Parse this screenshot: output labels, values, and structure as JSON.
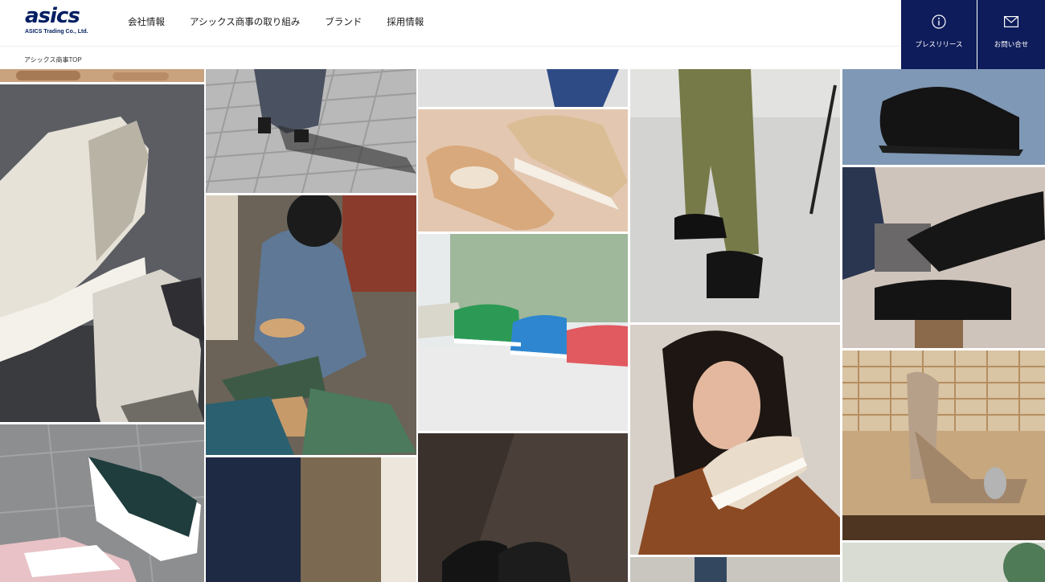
{
  "brand": {
    "logo_text": "asics",
    "company": "ASICS Trading Co., Ltd."
  },
  "nav": {
    "items": [
      {
        "label": "会社情報"
      },
      {
        "label": "アシックス商事の取り組み"
      },
      {
        "label": "ブランド"
      },
      {
        "label": "採用情報"
      }
    ]
  },
  "breadcrumb": {
    "current": "アシックス商事TOP"
  },
  "utility": {
    "press_label": "プレスリリース",
    "contact_label": "お問い合せ",
    "bg_color": "#0e1c5b"
  },
  "gallery": {
    "photos": [
      {
        "name": "photo-sandal-strip",
        "icon": "photo"
      },
      {
        "name": "photo-white-grey-sneakers",
        "icon": "photo"
      },
      {
        "name": "photo-kids-sneakers-floor",
        "icon": "photo"
      },
      {
        "name": "photo-paving-walkers",
        "icon": "photo"
      },
      {
        "name": "photo-craftsman-lasts",
        "icon": "photo"
      },
      {
        "name": "photo-trousers-shoes",
        "icon": "photo"
      },
      {
        "name": "photo-denim-top",
        "icon": "photo"
      },
      {
        "name": "photo-beige-slipons",
        "icon": "photo"
      },
      {
        "name": "photo-kids-sneakers-window",
        "icon": "photo"
      },
      {
        "name": "photo-black-loafers",
        "icon": "photo"
      },
      {
        "name": "photo-khaki-oxfords",
        "icon": "photo"
      },
      {
        "name": "photo-woman-holding-shoe",
        "icon": "photo"
      },
      {
        "name": "photo-bottom-strip",
        "icon": "photo"
      },
      {
        "name": "photo-black-strap-shoe",
        "icon": "photo"
      },
      {
        "name": "photo-black-oxfords-chair",
        "icon": "photo"
      },
      {
        "name": "photo-ballet-flats-wicker",
        "icon": "photo"
      },
      {
        "name": "photo-green-corner",
        "icon": "photo"
      }
    ]
  }
}
